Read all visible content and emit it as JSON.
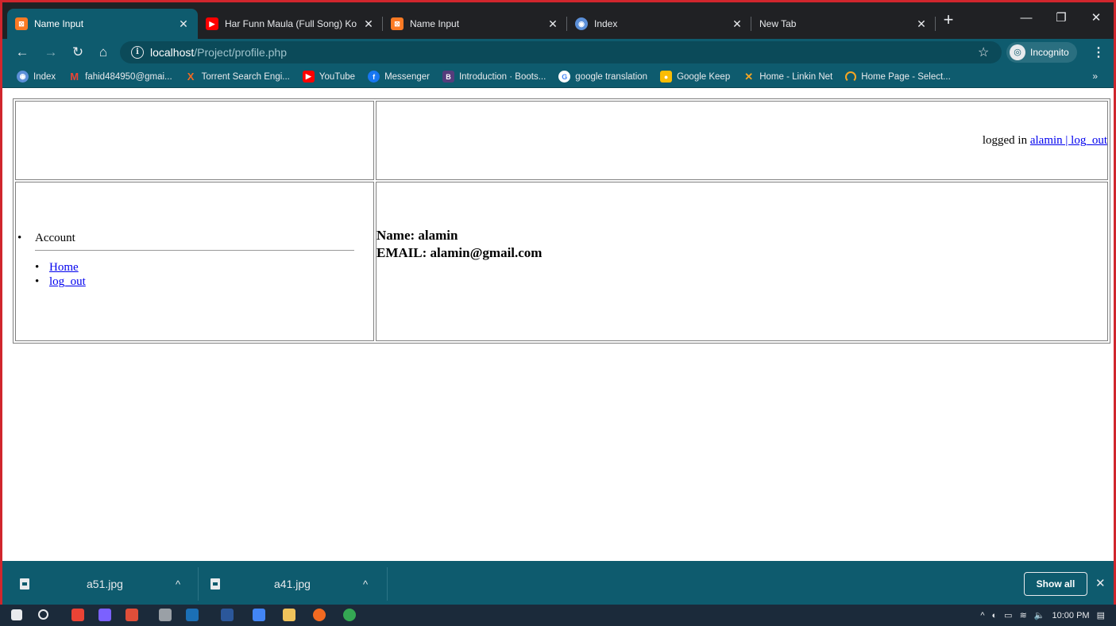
{
  "browser": {
    "tabs": [
      {
        "title": "Name Input",
        "favicon": "xampp-icon",
        "active": true
      },
      {
        "title": "Har Funn Maula (Full Song) Ko",
        "favicon": "youtube-icon",
        "active": false
      },
      {
        "title": "Name Input",
        "favicon": "xampp-icon",
        "active": false
      },
      {
        "title": "Index",
        "favicon": "globe-icon",
        "active": false
      },
      {
        "title": "New Tab",
        "favicon": "",
        "active": false
      }
    ],
    "address": {
      "host": "localhost",
      "path": "/Project/profile.php"
    },
    "incognito_label": "Incognito",
    "bookmarks": [
      {
        "label": "Index",
        "icon": "globe-icon"
      },
      {
        "label": "fahid484950@gmai...",
        "icon": "gmail-icon"
      },
      {
        "label": "Torrent Search Engi...",
        "icon": "torrent-icon"
      },
      {
        "label": "YouTube",
        "icon": "youtube-icon"
      },
      {
        "label": "Messenger",
        "icon": "facebook-icon"
      },
      {
        "label": "Introduction · Boots...",
        "icon": "bootstrap-icon"
      },
      {
        "label": "google translation",
        "icon": "google-icon"
      },
      {
        "label": "Google Keep",
        "icon": "keep-icon"
      },
      {
        "label": "Home - Linkin Net",
        "icon": "linkin-icon"
      },
      {
        "label": "Home Page - Select...",
        "icon": "loading-icon"
      }
    ],
    "bookmarks_more": "»"
  },
  "page": {
    "login_status": "logged in",
    "login_link": "alamin | log_out",
    "sidebar": {
      "account_label": "Account",
      "links": [
        "Home",
        "log_out"
      ]
    },
    "profile": {
      "name_line": "Name: alamin",
      "email_line": "EMAIL: alamin@gmail.com"
    }
  },
  "downloads": {
    "items": [
      "a51.jpg",
      "a41.jpg"
    ],
    "show_all_label": "Show all"
  },
  "taskbar": {
    "time": "10:00 PM"
  },
  "colors": {
    "chrome_accent": "#0e5b6e",
    "tab_strip": "#202124",
    "frame_border": "#d0262d",
    "link": "#0000ee"
  }
}
